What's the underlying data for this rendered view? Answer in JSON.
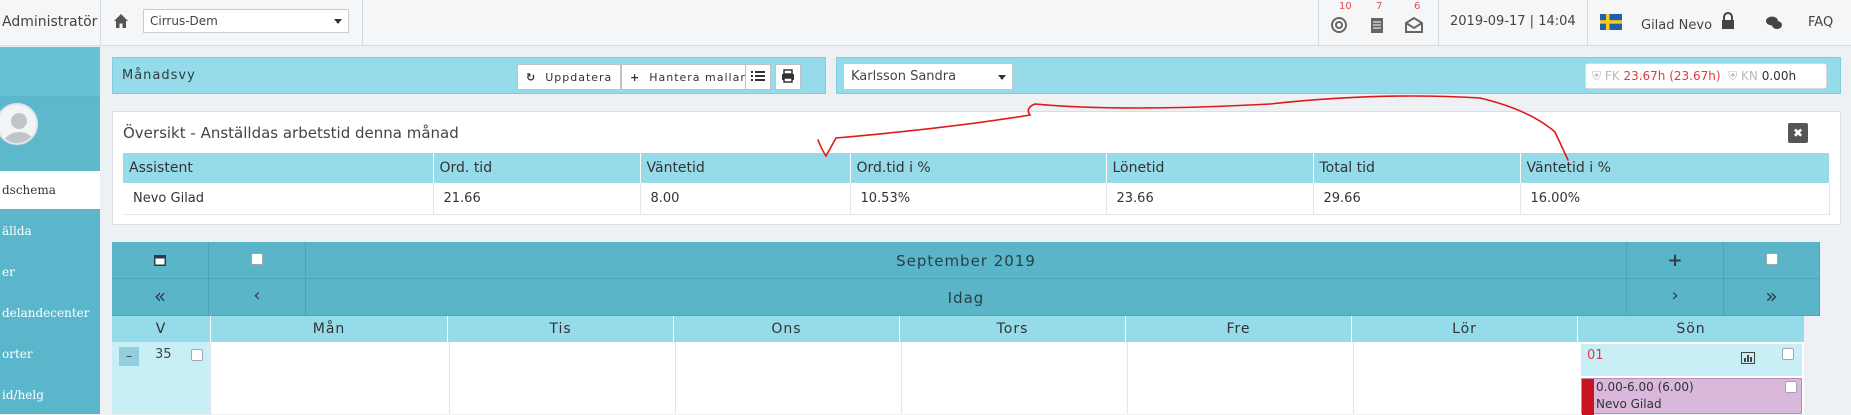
{
  "topbar": {
    "role": "Administratör",
    "company_value": "Cirrus-Dem",
    "badges": {
      "lifebuoy": "10",
      "document": "7",
      "mail": "6"
    },
    "datetime": "2019-09-17 | 14:04",
    "user": "Gilad Nevo",
    "faq": "FAQ",
    "flag_colors": {
      "blue": "#1f5fae",
      "yellow": "#f6cd18"
    }
  },
  "sidebar": {
    "items": [
      "dschema",
      "ällda",
      "er",
      "delandecenter",
      "orter",
      "id/helg"
    ]
  },
  "monthbar": {
    "title": "Månadsvy",
    "update_label": "Uppdatera",
    "templates_label": "Hantera mallar"
  },
  "personbar": {
    "selected_person": "Karlsson Sandra",
    "fk_label": "FK",
    "fk_value": "23.67h (23.67h)",
    "kn_label": "KN",
    "kn_value": "0.00h"
  },
  "overview": {
    "title": "Översikt - Anställdas arbetstid denna månad",
    "columns": [
      "Assistent",
      "Ord. tid",
      "Väntetid",
      "Ord.tid i %",
      "Lönetid",
      "Total tid",
      "Väntetid i %"
    ],
    "rows": [
      [
        "Nevo Gilad",
        "21.66",
        "8.00",
        "10.53%",
        "23.66",
        "29.66",
        "16.00%"
      ]
    ]
  },
  "calendar": {
    "month_title": "September 2019",
    "today_label": "Idag",
    "week_header": "V",
    "days": [
      "Mån",
      "Tis",
      "Ons",
      "Tors",
      "Fre",
      "Lör",
      "Sön"
    ],
    "week_number": "35",
    "collapse_label": "–",
    "sunday_date": "01",
    "shift_time": "0.00-6.00 (6.00)",
    "shift_person": "Nevo Gilad",
    "colors": {
      "header": "#5ab5c9",
      "light": "#96dbe9",
      "shift": "#d9b8dc",
      "shift_marker": "#c8141e"
    }
  }
}
